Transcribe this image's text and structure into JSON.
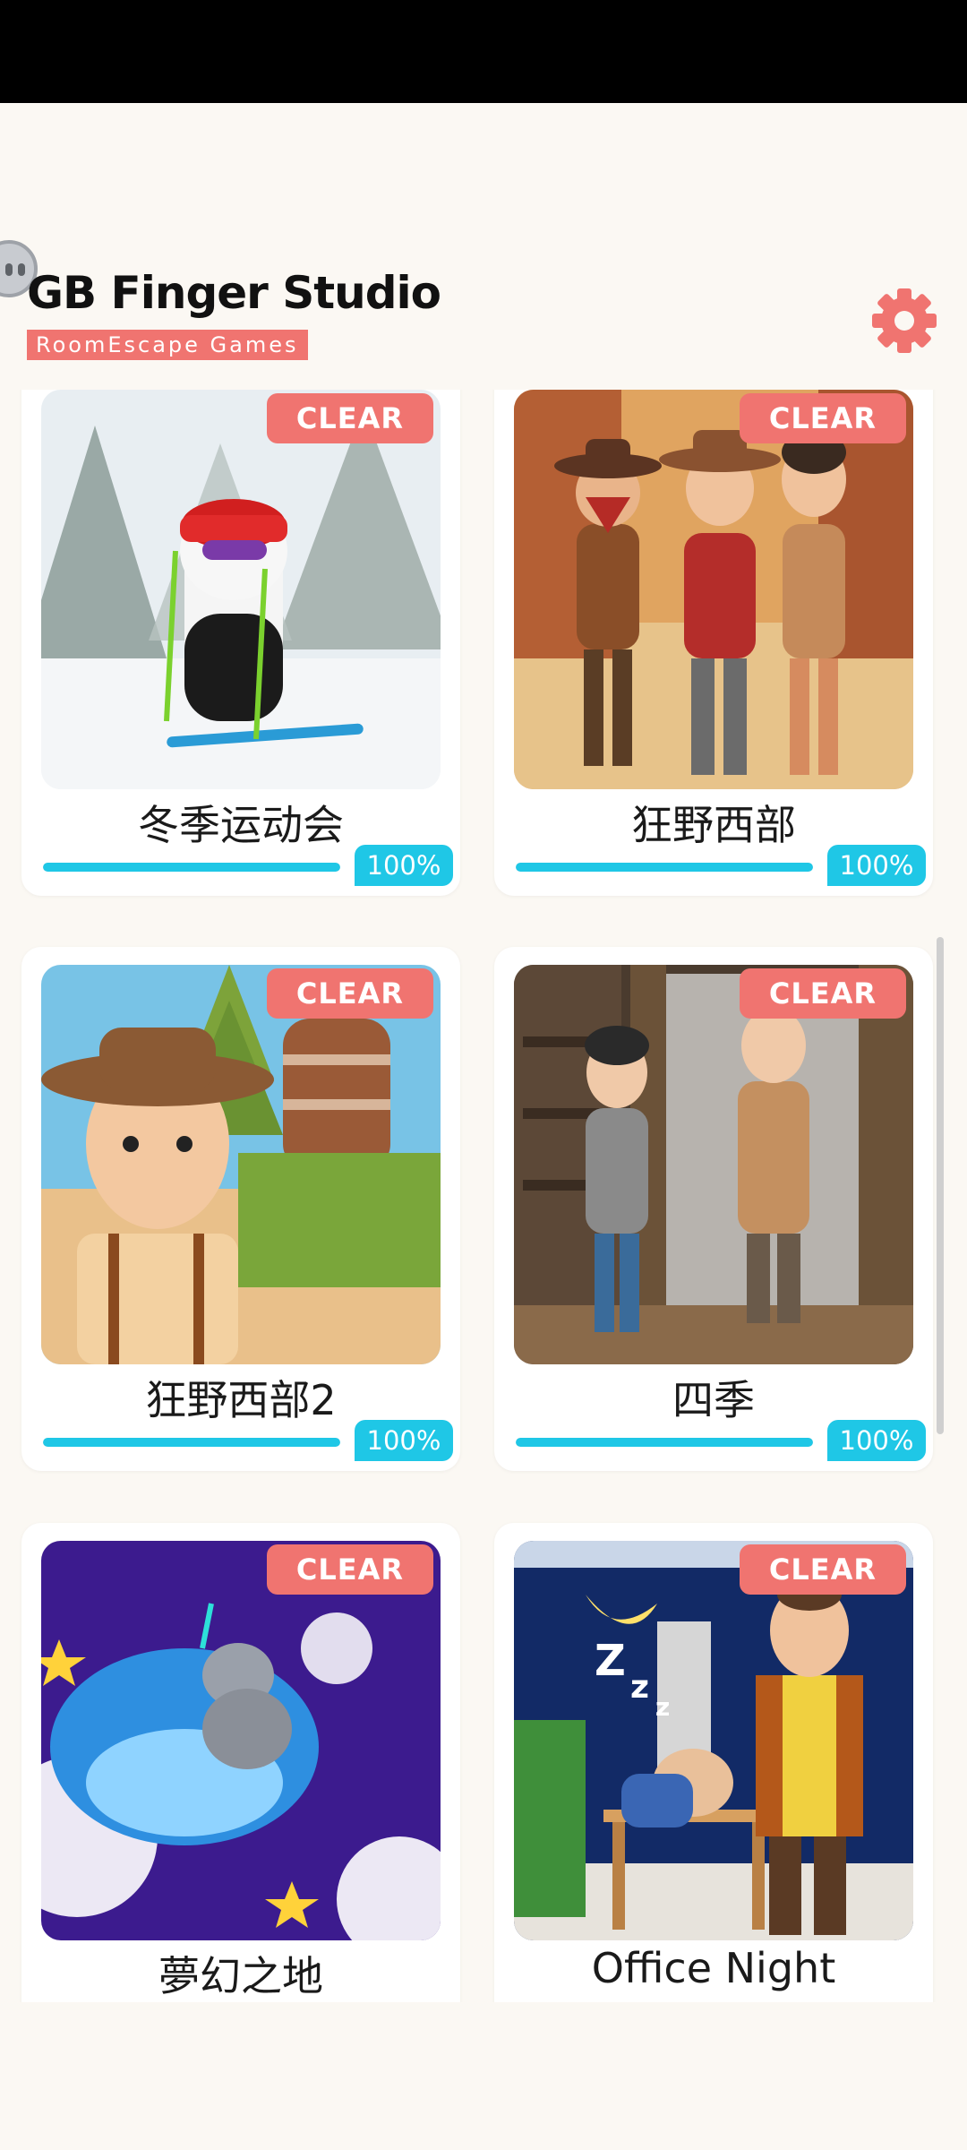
{
  "header": {
    "title": "GB Finger Studio",
    "subtitle": "RoomEscape Games",
    "settings_icon": "gear-icon",
    "accent_color": "#f07470"
  },
  "progress_color": "#1fc7e6",
  "games": [
    {
      "title": "冬季运动会",
      "badge": "CLEAR",
      "progress_label": "100%",
      "progress": 1.0
    },
    {
      "title": "狂野西部",
      "badge": "CLEAR",
      "progress_label": "100%",
      "progress": 1.0
    },
    {
      "title": "狂野西部2",
      "badge": "CLEAR",
      "progress_label": "100%",
      "progress": 1.0
    },
    {
      "title": "四季",
      "badge": "CLEAR",
      "progress_label": "100%",
      "progress": 1.0
    },
    {
      "title": "夢幻之地",
      "badge": "CLEAR"
    },
    {
      "title": "Office Night",
      "badge": "CLEAR"
    }
  ]
}
